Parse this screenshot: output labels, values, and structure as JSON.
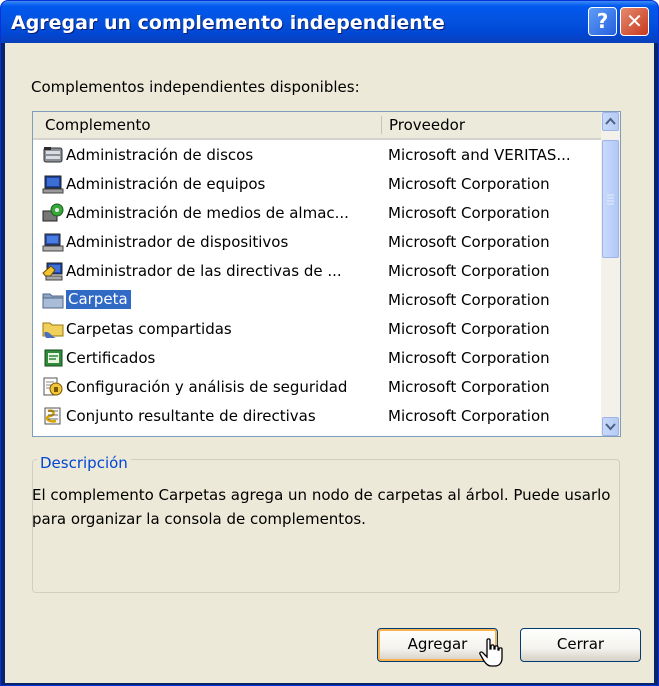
{
  "window": {
    "title": "Agregar un complemento independiente",
    "help_label": "?",
    "close_label": "✕"
  },
  "list_label": "Complementos independientes disponibles:",
  "columns": {
    "name": "Complemento",
    "provider": "Proveedor"
  },
  "rows": [
    {
      "name": "Administración de discos",
      "provider": "Microsoft and VERITAS...",
      "icon": "disk-management-icon",
      "selected": false
    },
    {
      "name": "Administración de equipos",
      "provider": "Microsoft Corporation",
      "icon": "computer-management-icon",
      "selected": false
    },
    {
      "name": "Administración de medios de almac...",
      "provider": "Microsoft Corporation",
      "icon": "removable-storage-icon",
      "selected": false
    },
    {
      "name": "Administrador de dispositivos",
      "provider": "Microsoft Corporation",
      "icon": "device-manager-icon",
      "selected": false
    },
    {
      "name": "Administrador de las directivas de ...",
      "provider": "Microsoft Corporation",
      "icon": "policy-manager-icon",
      "selected": false
    },
    {
      "name": "Carpeta",
      "provider": "Microsoft Corporation",
      "icon": "folder-icon",
      "selected": true
    },
    {
      "name": "Carpetas compartidas",
      "provider": "Microsoft Corporation",
      "icon": "shared-folders-icon",
      "selected": false
    },
    {
      "name": "Certificados",
      "provider": "Microsoft Corporation",
      "icon": "certificates-icon",
      "selected": false
    },
    {
      "name": "Configuración y análisis de seguridad",
      "provider": "Microsoft Corporation",
      "icon": "security-analysis-icon",
      "selected": false
    },
    {
      "name": "Conjunto resultante de directivas",
      "provider": "Microsoft Corporation",
      "icon": "rsop-icon",
      "selected": false
    }
  ],
  "description": {
    "title": "Descripción",
    "text": "El complemento Carpetas agrega un nodo de carpetas al árbol. Puede usarlo para organizar la consola de complementos."
  },
  "buttons": {
    "add": "Agregar",
    "close": "Cerrar"
  },
  "colors": {
    "selection": "#316ac5",
    "titlebar": "#0058ee",
    "face": "#ece9d8",
    "groupbox_title": "#0046d5"
  }
}
